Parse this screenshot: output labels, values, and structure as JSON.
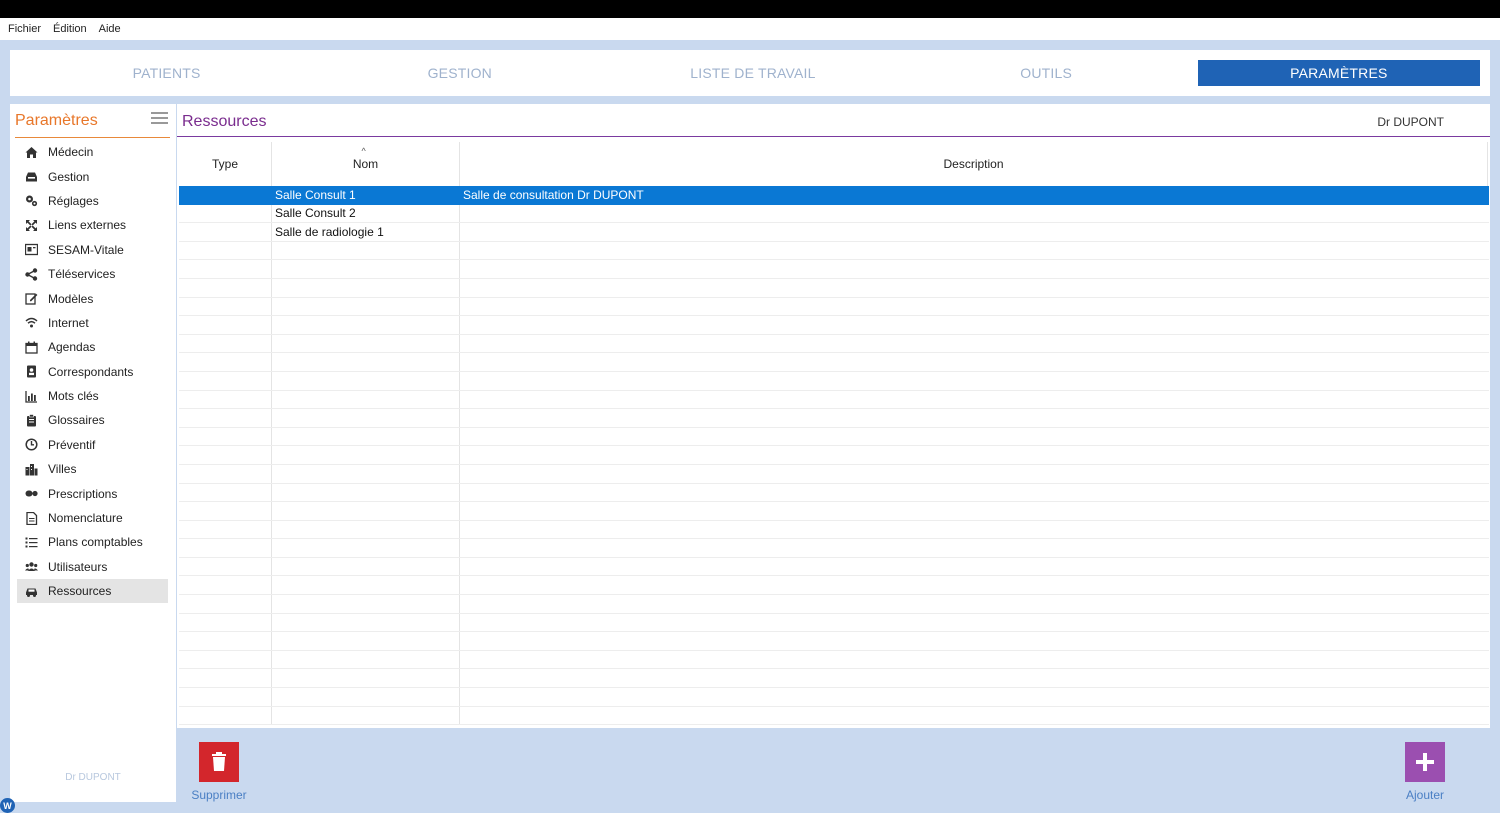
{
  "menu": [
    "Fichier",
    "Édition",
    "Aide"
  ],
  "tabs": [
    "PATIENTS",
    "GESTION",
    "LISTE DE TRAVAIL",
    "OUTILS",
    "PARAMÈTRES"
  ],
  "active_tab": "PARAMÈTRES",
  "sidebar": {
    "title": "Paramètres",
    "items": [
      {
        "label": "Médecin",
        "icon": "home-icon"
      },
      {
        "label": "Gestion",
        "icon": "inbox-icon"
      },
      {
        "label": "Réglages",
        "icon": "cogs-icon"
      },
      {
        "label": "Liens externes",
        "icon": "expand-arrows-icon"
      },
      {
        "label": "SESAM-Vitale",
        "icon": "card-reader-icon"
      },
      {
        "label": "Téléservices",
        "icon": "share-icon"
      },
      {
        "label": "Modèles",
        "icon": "edit-icon"
      },
      {
        "label": "Internet",
        "icon": "wifi-icon"
      },
      {
        "label": "Agendas",
        "icon": "calendar-icon"
      },
      {
        "label": "Correspondants",
        "icon": "contact-card-icon"
      },
      {
        "label": "Mots clés",
        "icon": "bar-chart-icon"
      },
      {
        "label": "Glossaires",
        "icon": "clipboard-icon"
      },
      {
        "label": "Préventif",
        "icon": "clock-icon"
      },
      {
        "label": "Villes",
        "icon": "city-icon"
      },
      {
        "label": "Prescriptions",
        "icon": "pills-icon"
      },
      {
        "label": "Nomenclature",
        "icon": "document-icon"
      },
      {
        "label": "Plans comptables",
        "icon": "list-icon"
      },
      {
        "label": "Utilisateurs",
        "icon": "users-icon"
      },
      {
        "label": "Ressources",
        "icon": "car-icon"
      }
    ],
    "selected": "Ressources",
    "user": "Dr DUPONT"
  },
  "main": {
    "title": "Ressources",
    "user": "Dr DUPONT",
    "columns": [
      "Type",
      "Nom",
      "Description"
    ],
    "rows": [
      {
        "type": "",
        "nom": "Salle Consult 1",
        "description": "Salle de consultation Dr DUPONT",
        "selected": true
      },
      {
        "type": "",
        "nom": "Salle Consult 2",
        "description": "",
        "selected": false
      },
      {
        "type": "",
        "nom": "Salle de radiologie 1",
        "description": "",
        "selected": false
      }
    ]
  },
  "actions": {
    "delete_label": "Supprimer",
    "add_label": "Ajouter"
  },
  "colors": {
    "accent_blue": "#1f63b5",
    "selection_blue": "#0a78d4",
    "sidebar_title_orange": "#e8772a",
    "main_title_purple": "#7a2c8e",
    "delete_red": "#d3262c",
    "add_purple": "#9b4fb0",
    "background": "#c9d9ef"
  }
}
